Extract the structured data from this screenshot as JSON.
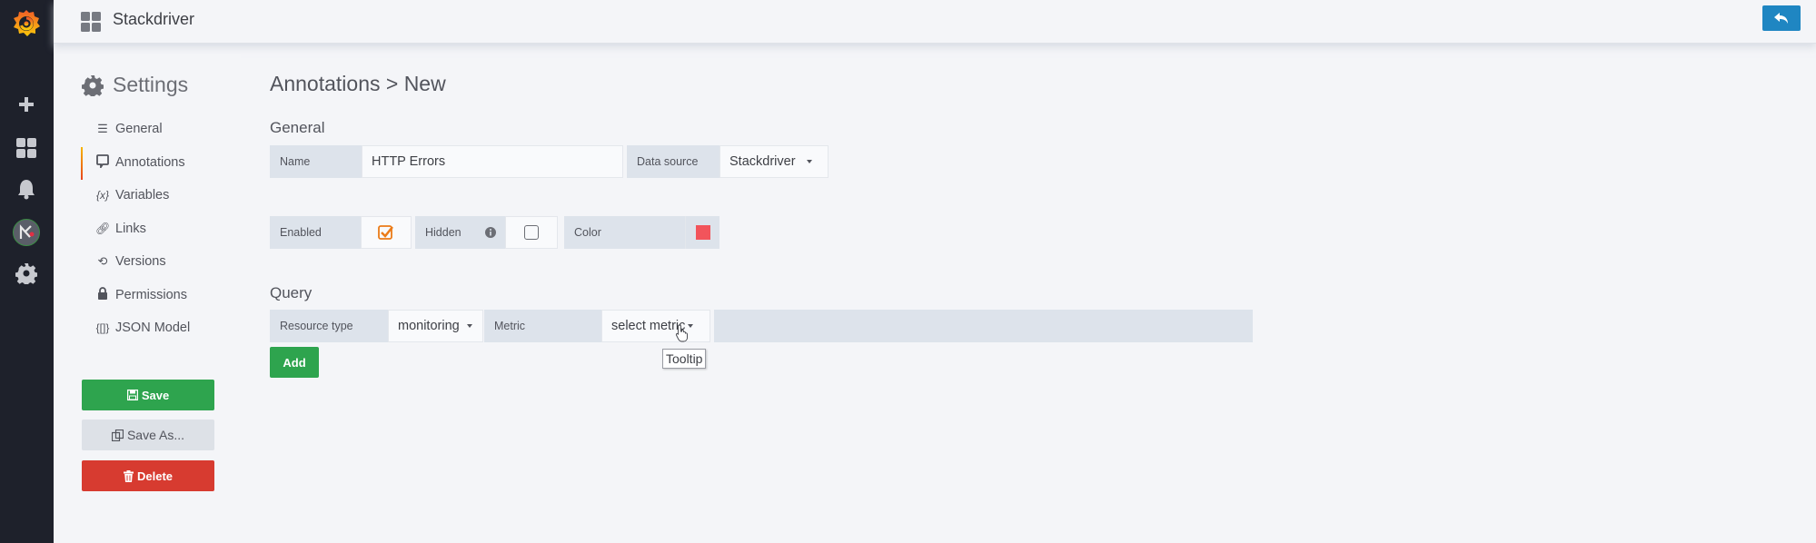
{
  "app": {
    "title": "Stackdriver",
    "brand_color": "#f46800",
    "back_button_color": "#1f86c2"
  },
  "nav": {
    "icons": [
      "grafana-logo",
      "plus-icon",
      "dashboards-icon",
      "bell-icon",
      "user-avatar",
      "gear-icon"
    ]
  },
  "settings": {
    "title": "Settings",
    "menu": [
      {
        "label": "General",
        "icon": "sliders-icon",
        "active": false
      },
      {
        "label": "Annotations",
        "icon": "comment-icon",
        "active": true
      },
      {
        "label": "Variables",
        "icon": "variable-icon",
        "active": false
      },
      {
        "label": "Links",
        "icon": "link-icon",
        "active": false
      },
      {
        "label": "Versions",
        "icon": "history-icon",
        "active": false
      },
      {
        "label": "Permissions",
        "icon": "lock-icon",
        "active": false
      },
      {
        "label": "JSON Model",
        "icon": "json-icon",
        "active": false
      }
    ],
    "buttons": {
      "save": "Save",
      "save_as": "Save As...",
      "delete": "Delete"
    }
  },
  "main": {
    "page_title": "Annotations > New",
    "general": {
      "heading": "General",
      "name_label": "Name",
      "name_value": "HTTP Errors",
      "datasource_label": "Data source",
      "datasource_value": "Stackdriver",
      "enabled_label": "Enabled",
      "enabled_checked": true,
      "hidden_label": "Hidden",
      "hidden_checked": false,
      "color_label": "Color",
      "color_value": "#f2545b"
    },
    "query": {
      "heading": "Query",
      "resource_type_label": "Resource type",
      "resource_type_value": "monitoring",
      "metric_label": "Metric",
      "metric_value": "select metric",
      "add_label": "Add",
      "tooltip": "Tooltip"
    }
  }
}
